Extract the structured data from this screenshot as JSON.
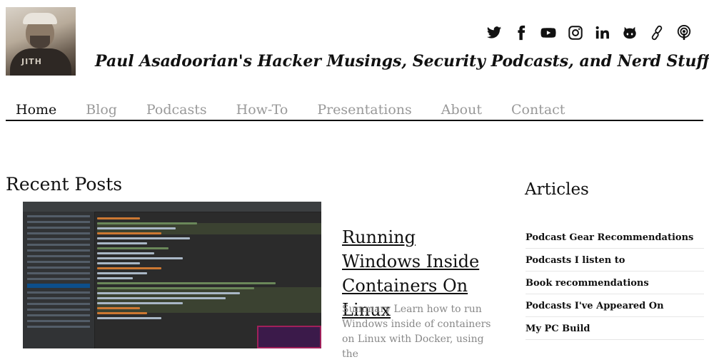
{
  "header": {
    "title": "Paul Asadoorian's Hacker Musings, Security Podcasts, and Nerd Stuff.",
    "avatar_shirt_text": "JITH"
  },
  "social": [
    {
      "icon": "twitter-icon"
    },
    {
      "icon": "facebook-icon"
    },
    {
      "icon": "youtube-icon"
    },
    {
      "icon": "instagram-icon"
    },
    {
      "icon": "linkedin-icon"
    },
    {
      "icon": "github-icon"
    },
    {
      "icon": "link-icon"
    },
    {
      "icon": "podcast-icon"
    }
  ],
  "nav": {
    "items": [
      {
        "label": "Home",
        "active": true
      },
      {
        "label": "Blog"
      },
      {
        "label": "Podcasts"
      },
      {
        "label": "How-To"
      },
      {
        "label": "Presentations"
      },
      {
        "label": "About"
      },
      {
        "label": "Contact"
      }
    ]
  },
  "recent": {
    "heading": "Recent Posts",
    "post": {
      "title": "Running Windows Inside Containers On Linux",
      "summary": "Summary Learn how to run Windows inside of containers on Linux with Docker, using the"
    }
  },
  "articles": {
    "heading": "Articles",
    "items": [
      "Podcast Gear Recommendations",
      "Podcasts I listen to",
      "Book recommendations",
      "Podcasts I've Appeared On",
      "My PC Build"
    ]
  },
  "colors": {
    "nav_active": "#111111",
    "nav_inactive": "#999999",
    "summary_text": "#888888"
  }
}
